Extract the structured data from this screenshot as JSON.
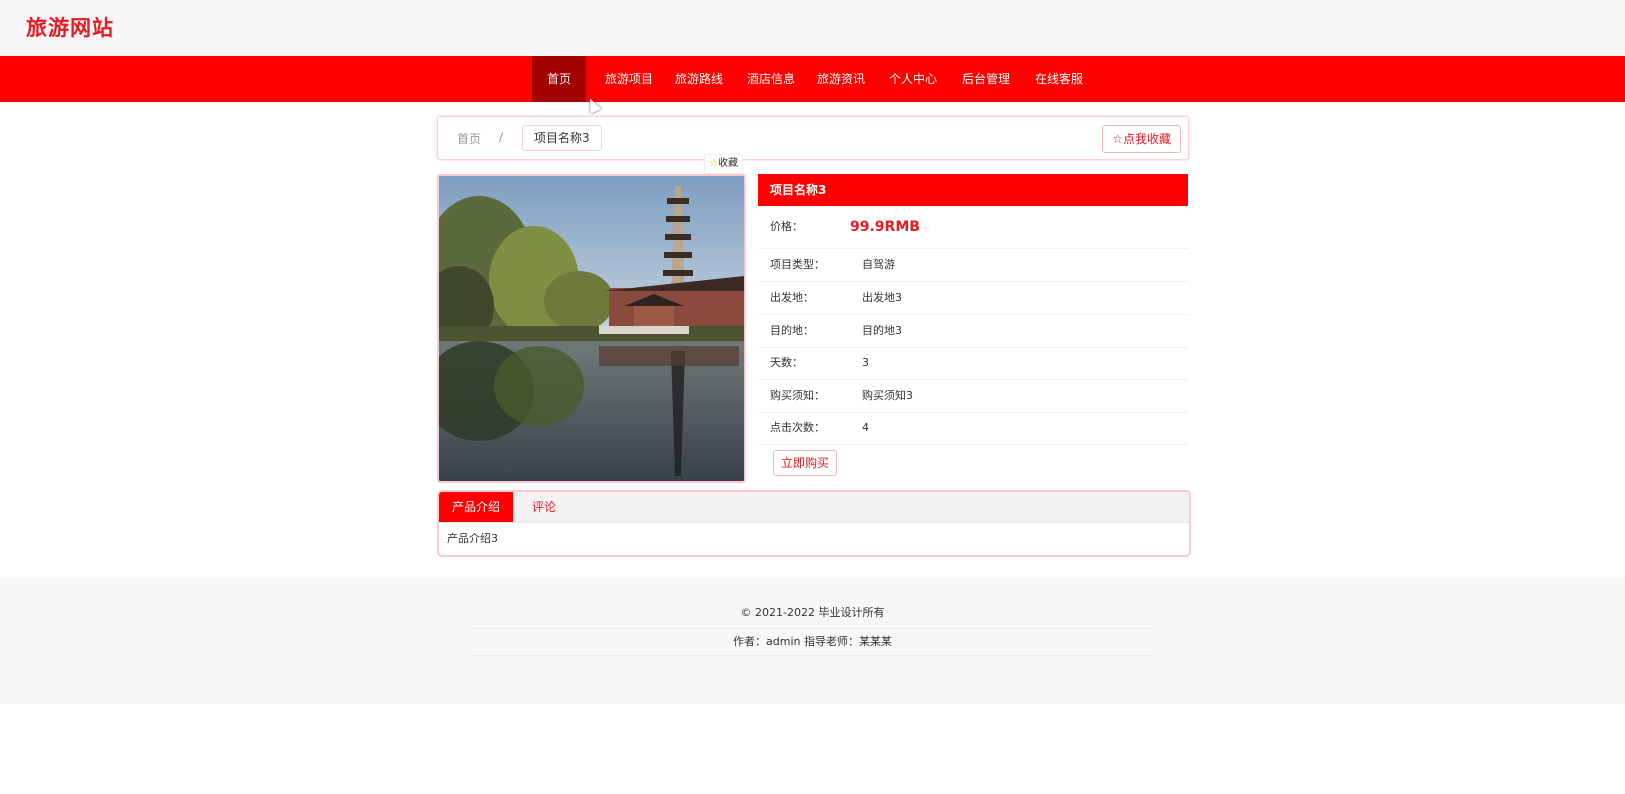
{
  "site": {
    "title": "旅游网站"
  },
  "nav": {
    "items": [
      {
        "label": "首页",
        "active": true
      },
      {
        "label": "旅游项目"
      },
      {
        "label": "旅游路线"
      },
      {
        "label": "酒店信息"
      },
      {
        "label": "旅游资讯"
      },
      {
        "label": "个人中心"
      },
      {
        "label": "后台管理"
      },
      {
        "label": "在线客服"
      }
    ]
  },
  "breadcrumb": {
    "home": "首页",
    "separator": "/",
    "current": "项目名称3"
  },
  "favorite": {
    "button_label": "点我收藏",
    "mini_label": "收藏"
  },
  "detail": {
    "name": "项目名称3",
    "price_label": "价格：",
    "price_value": "99.9RMB",
    "fields": [
      {
        "label": "项目类型：",
        "value": "自驾游"
      },
      {
        "label": "出发地：",
        "value": "出发地3"
      },
      {
        "label": "目的地：",
        "value": "目的地3"
      },
      {
        "label": "天数：",
        "value": "3"
      },
      {
        "label": "购买须知：",
        "value": "购买须知3"
      },
      {
        "label": "点击次数：",
        "value": "4"
      }
    ],
    "buy_label": "立即购买"
  },
  "tabs": {
    "items": [
      {
        "label": "产品介绍",
        "active": true
      },
      {
        "label": "评论"
      }
    ],
    "body": "产品介绍3"
  },
  "footer": {
    "copyright": "© 2021-2022 毕业设计所有",
    "authors": "作者：admin 指导老师：某某某"
  },
  "colors": {
    "accent": "#ff0000",
    "active_nav": "#a30000",
    "brand_text": "#e51c23",
    "pink_border": "#ffc7cf"
  }
}
